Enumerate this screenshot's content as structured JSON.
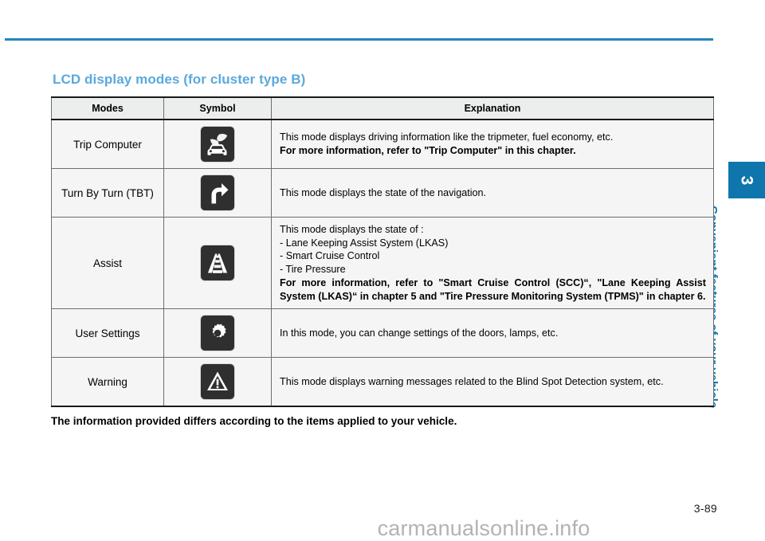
{
  "document": {
    "heading": "LCD display modes (for cluster type B)",
    "page_number": "3-89",
    "watermark": "carmanualsonline.info",
    "footnote": "The information provided differs according to the items applied to your vehicle.",
    "accent_color": "#2585bd",
    "heading_color": "#5aa9dd"
  },
  "sidebar": {
    "chapter_number": "3",
    "chapter_title": "Convenient features of your vehicle",
    "tab_color": "#0e76ad"
  },
  "table": {
    "headers": [
      "Modes",
      "Symbol",
      "Explanation"
    ],
    "rows": [
      {
        "mode": "Trip Computer",
        "symbol": "eco-car-leaf-icon",
        "explanation_lines": [
          {
            "text": "This mode displays driving information like the tripmeter, fuel economy, etc.",
            "bold": false
          },
          {
            "text": "For more information, refer to \"Trip Computer\" in this chapter.",
            "bold": true
          }
        ]
      },
      {
        "mode": "Turn By Turn (TBT)",
        "symbol": "turn-right-arrow-icon",
        "explanation_lines": [
          {
            "text": "This mode displays the state of the navigation.",
            "bold": false
          }
        ]
      },
      {
        "mode": "Assist",
        "symbol": "lane-road-icon",
        "explanation_lines": [
          {
            "text": "This mode displays the state of :",
            "bold": false
          },
          {
            "text": "- Lane Keeping Assist System (LKAS)",
            "bold": false
          },
          {
            "text": "- Smart Cruise Control",
            "bold": false
          },
          {
            "text": "- Tire Pressure",
            "bold": false
          },
          {
            "text": "For more information, refer to \"Smart Cruise Control (SCC)“, \"Lane Keeping Assist System (LKAS)“ in chapter 5 and \"Tire Pressure Monitoring System (TPMS)\" in chapter 6.",
            "bold": true
          }
        ]
      },
      {
        "mode": "User Settings",
        "symbol": "gear-icon",
        "explanation_lines": [
          {
            "text": "In this mode, you can change settings of the doors, lamps, etc.",
            "bold": false
          }
        ]
      },
      {
        "mode": "Warning",
        "symbol": "warning-triangle-icon",
        "explanation_lines": [
          {
            "text": "This mode displays warning messages related to the Blind Spot Detection system, etc.",
            "bold": false
          }
        ]
      }
    ]
  }
}
